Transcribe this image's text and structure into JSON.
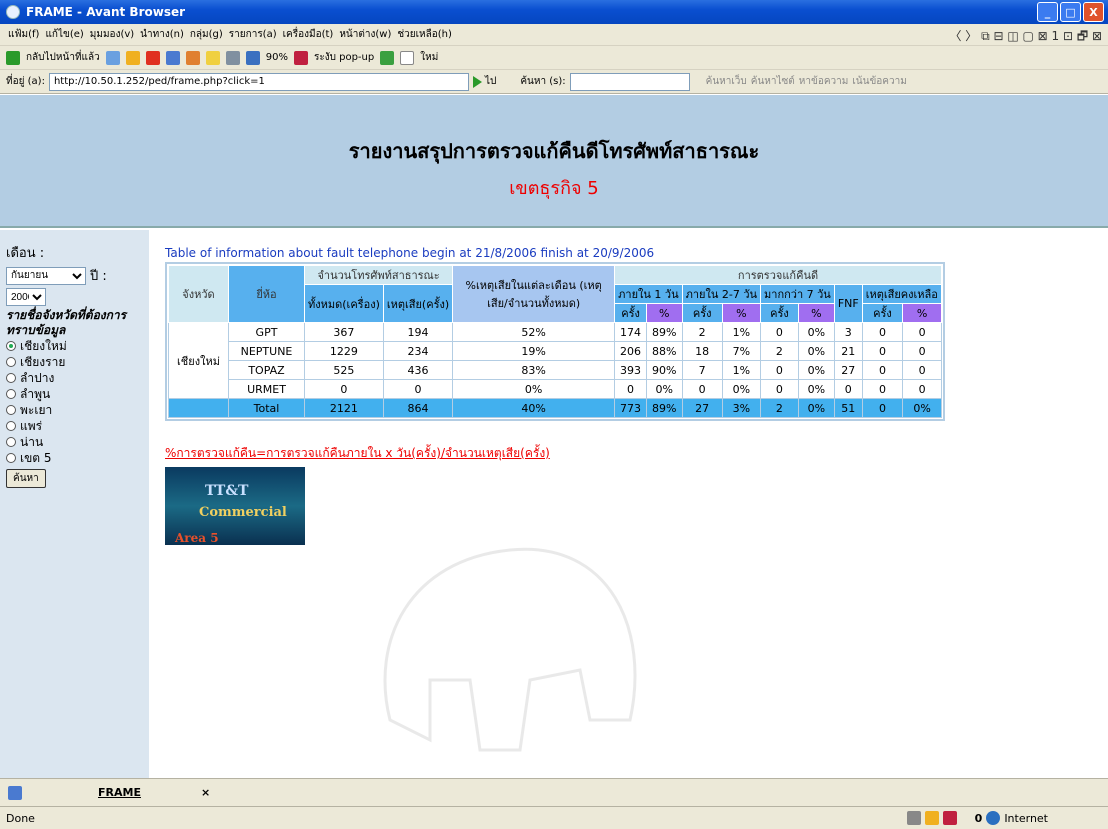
{
  "window": {
    "title": "FRAME - Avant Browser",
    "btn_min": "_",
    "btn_max": "□",
    "btn_close": "X"
  },
  "menu": [
    "แฟ้ม(f)",
    "แก้ไข(e)",
    "มุมมอง(v)",
    "นำทาง(n)",
    "กลุ่ม(g)",
    "รายการ(a)",
    "เครื่องมือ(t)",
    "หน้าต่าง(w)",
    "ช่วยเหลือ(h)"
  ],
  "menu_right": "〈 〉 ⧉ ⊟ ◫ ▢ ⊠ 1 ⊡ 🗗 ⊠",
  "toolbar": {
    "back": "กลับไปหน้าที่แล้ว",
    "zoom": "90%",
    "popup": "ระงับ pop-up",
    "new": "ใหม่"
  },
  "address": {
    "label": "ที่อยู่ (a):",
    "url": "http://10.50.1.252/ped/frame.php?click=1",
    "go": "ไป",
    "search_label": "ค้นหา (s):",
    "web_search": "ค้นหาเว็บ",
    "site_search": "ค้นหาไซต์",
    "find_text": "หาข้อความ",
    "highlight": "เน้นข้อความ"
  },
  "header": {
    "title": "รายงานสรุปการตรวจแก้คืนดีโทรศัพท์สาธารณะ",
    "subtitle": "เขตธุรกิจ 5"
  },
  "sidebar": {
    "month_label": "เดือน :",
    "month_value": "กันยายน",
    "year_label": "ปี :",
    "year_value": "2006",
    "hint": "รายชื่อจังหวัดที่ต้องการทราบข้อมูล",
    "provinces": [
      "เชียงใหม่",
      "เชียงราย",
      "ลำปาง",
      "ลำพูน",
      "พะเยา",
      "แพร่",
      "น่าน",
      "เขต 5"
    ],
    "selected": 0,
    "search_btn": "ค้นหา"
  },
  "main": {
    "table_title": "Table of information about fault telephone begin at 21/8/2006 finish at 20/9/2006",
    "h_province": "จังหวัด",
    "h_brand": "ยี่ห้อ",
    "h_phones": "จำนวนโทรศัพท์สาธารณะ",
    "h_total": "ทั้งหมด(เครื่อง)",
    "h_faults": "เหตุเสีย(ครั้ง)",
    "h_pct": "%เหตุเสียในแต่ละเดือน (เหตุเสีย/จำนวนทั้งหมด)",
    "h_repair": "การตรวจแก้คืนดี",
    "h_d1": "ภายใน 1 วัน",
    "h_d27": "ภายใน 2-7 วัน",
    "h_d7": "มากกว่า 7 วัน",
    "h_fnf": "FNF",
    "h_remain": "เหตุเสียคงเหลือ",
    "h_times": "ครั้ง",
    "h_percent": "%",
    "province": "เชียงใหม่",
    "rows": [
      [
        "GPT",
        "367",
        "194",
        "52%",
        "174",
        "89%",
        "2",
        "1%",
        "0",
        "0%",
        "3",
        "0",
        "0"
      ],
      [
        "NEPTUNE",
        "1229",
        "234",
        "19%",
        "206",
        "88%",
        "18",
        "7%",
        "2",
        "0%",
        "21",
        "0",
        "0"
      ],
      [
        "TOPAZ",
        "525",
        "436",
        "83%",
        "393",
        "90%",
        "7",
        "1%",
        "0",
        "0%",
        "27",
        "0",
        "0"
      ],
      [
        "URMET",
        "0",
        "0",
        "0%",
        "0",
        "0%",
        "0",
        "0%",
        "0",
        "0%",
        "0",
        "0",
        "0"
      ]
    ],
    "total": [
      "Total",
      "2121",
      "864",
      "40%",
      "773",
      "89%",
      "27",
      "3%",
      "2",
      "0%",
      "51",
      "0",
      "0%"
    ],
    "formula": "%การตรวจแก้คืน=การตรวจแก้คืนภายใน x วัน(ครั้ง)/จำนวนเหตุเสีย(ครั้ง)",
    "promo": {
      "l1": "TT&T",
      "l2": "Commercial",
      "l3": "Area 5"
    }
  },
  "taskbar": {
    "tab": "FRAME",
    "close": "×"
  },
  "status": {
    "text": "Done",
    "count": "0",
    "zone": "Internet"
  }
}
